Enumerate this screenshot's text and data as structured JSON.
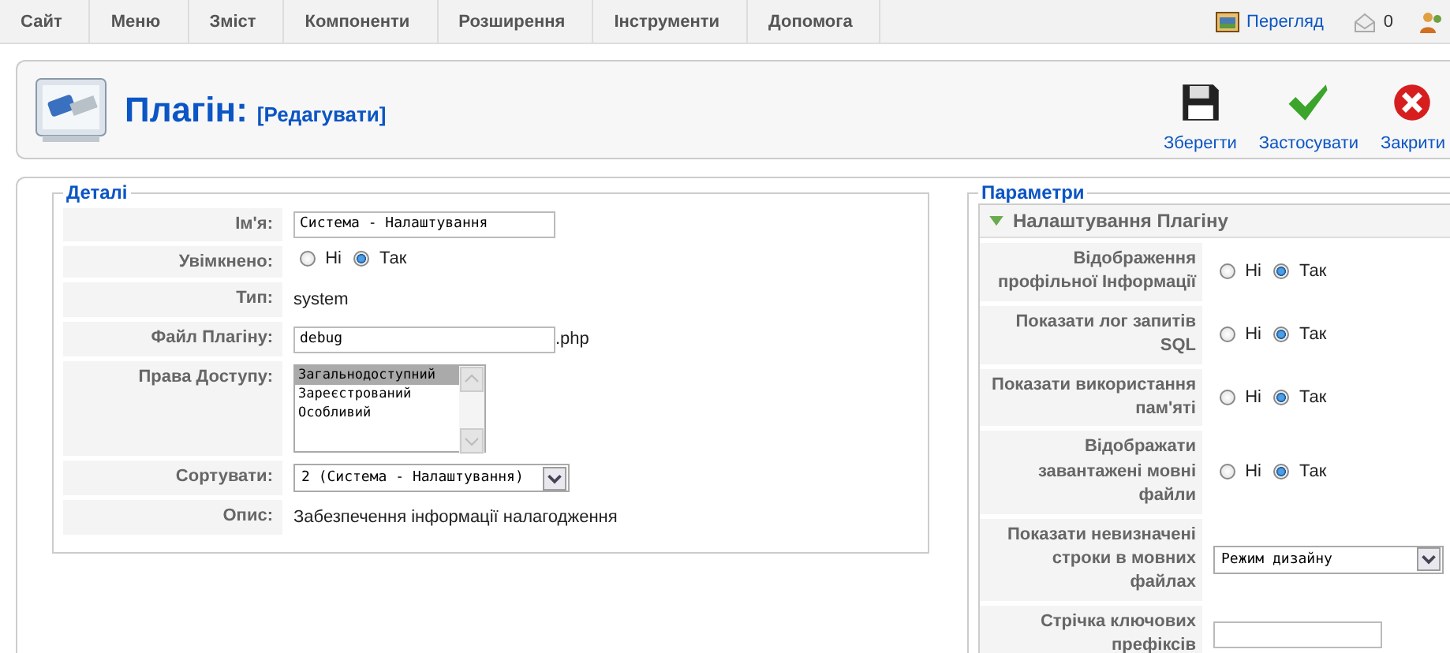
{
  "menu": [
    {
      "label": "Сайт"
    },
    {
      "label": "Меню"
    },
    {
      "label": "Зміст"
    },
    {
      "label": "Компоненти"
    },
    {
      "label": "Розширення"
    },
    {
      "label": "Інструменти"
    },
    {
      "label": "Допомога"
    }
  ],
  "status": {
    "preview": "Перегляд",
    "messages": "0"
  },
  "header": {
    "title": "Плагін:",
    "subtitle": "[Редагувати]"
  },
  "toolbar": [
    {
      "kind": "save",
      "label": "Зберегти"
    },
    {
      "kind": "apply",
      "label": "Застосувати"
    },
    {
      "kind": "close",
      "label": "Закрити"
    }
  ],
  "details": {
    "legend": "Деталі",
    "rows": [
      {
        "kind": "input",
        "label": "Ім'я:",
        "value": "Система - Налаштування"
      },
      {
        "kind": "radio",
        "label": "Увімкнено:",
        "options": [
          {
            "label": "Ні",
            "selected": false
          },
          {
            "label": "Так",
            "selected": true
          }
        ]
      },
      {
        "kind": "text",
        "label": "Тип:",
        "value": "system"
      },
      {
        "kind": "file",
        "label": "Файл Плагіну:",
        "value": "debug",
        "suffix": ".php"
      },
      {
        "kind": "list",
        "label": "Права Доступу:",
        "items": [
          {
            "label": "Загальнодоступний",
            "selected": true
          },
          {
            "label": "Зареєстрований",
            "selected": false
          },
          {
            "label": "Особливий",
            "selected": false
          }
        ]
      },
      {
        "kind": "select",
        "label": "Сортувати:",
        "value": "2 (Система - Налаштування)"
      },
      {
        "kind": "text",
        "label": "Опис:",
        "value": "Забезпечення інформації налагодження"
      }
    ]
  },
  "params": {
    "legend": "Параметри",
    "panel": {
      "title": "Налаштування Плагіну",
      "expanded": true
    },
    "rows": [
      {
        "kind": "radio",
        "label": "Відображення профільної Інформації",
        "options": [
          {
            "label": "Ні",
            "selected": false
          },
          {
            "label": "Так",
            "selected": true
          }
        ]
      },
      {
        "kind": "radio",
        "label": "Показати лог запитів SQL",
        "options": [
          {
            "label": "Ні",
            "selected": false
          },
          {
            "label": "Так",
            "selected": true
          }
        ]
      },
      {
        "kind": "radio",
        "label": "Показати використання пам'яті",
        "options": [
          {
            "label": "Ні",
            "selected": false
          },
          {
            "label": "Так",
            "selected": true
          }
        ]
      },
      {
        "kind": "radio",
        "label": "Відображати завантажені мовні файли",
        "options": [
          {
            "label": "Ні",
            "selected": false
          },
          {
            "label": "Так",
            "selected": true
          }
        ]
      },
      {
        "kind": "select",
        "label": "Показати невизначені строки в мовних файлах",
        "value": "Режим дизайну"
      },
      {
        "kind": "input",
        "label": "Стрічка ключових префіксів"
      }
    ]
  }
}
